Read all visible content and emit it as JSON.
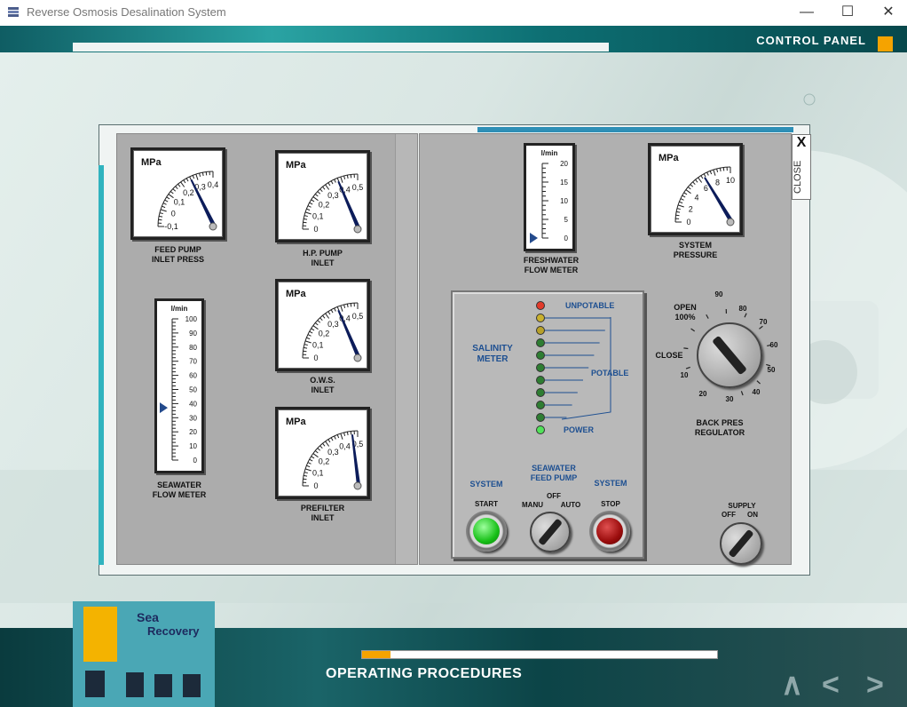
{
  "window": {
    "title": "Reverse Osmosis Desalination System",
    "controls": {
      "minimize": "—",
      "maximize": "☐",
      "close": "✕"
    }
  },
  "header": {
    "control_panel": "CONTROL PANEL",
    "accent": "#f5a300"
  },
  "footer": {
    "operating_procedures": "OPERATING PROCEDURES",
    "progress": 0.08,
    "nav": {
      "up": "∧",
      "prev": "<",
      "next": ">"
    }
  },
  "thumbnail": {
    "brand_line1": "Sea",
    "brand_line2": "Recovery"
  },
  "close": {
    "x": "X",
    "label": "CLOSE"
  },
  "gauges": {
    "feed_pump": {
      "unit": "MPa",
      "ticks": [
        "-0,1",
        "0",
        "0,1",
        "0,2",
        "0,3",
        "0,4"
      ],
      "label1": "FEED  PUMP",
      "label2": "INLET PRESS"
    },
    "hp_pump": {
      "unit": "MPa",
      "ticks": [
        "0",
        "0,1",
        "0,2",
        "0,3",
        "0,4",
        "0,5"
      ],
      "label1": "H.P. PUMP",
      "label2": "INLET"
    },
    "ows": {
      "unit": "MPa",
      "ticks": [
        "0",
        "0,1",
        "0,2",
        "0,3",
        "0,4",
        "0,5"
      ],
      "label1": "O.W.S.",
      "label2": "INLET"
    },
    "prefilter": {
      "unit": "MPa",
      "ticks": [
        "0",
        "0,1",
        "0,2",
        "0,3",
        "0,4",
        "0,5"
      ],
      "label1": "PREFILTER",
      "label2": "INLET"
    },
    "system": {
      "unit": "MPa",
      "ticks": [
        "0",
        "2",
        "4",
        "6",
        "8",
        "10"
      ],
      "label1": "SYSTEM",
      "label2": "PRESSURE"
    }
  },
  "flowmeters": {
    "seawater": {
      "unit": "l/min",
      "ticks": [
        "100",
        "90",
        "80",
        "70",
        "60",
        "50",
        "40",
        "30",
        "20",
        "10",
        "0"
      ],
      "label1": "SEAWATER",
      "label2": "FLOW METER",
      "value": 37
    },
    "freshwater": {
      "unit": "l/min",
      "ticks": [
        "20",
        "15",
        "10",
        "5",
        "0"
      ],
      "label1": "FRESHWATER",
      "label2": "FLOW METER",
      "value": 0
    }
  },
  "salinity": {
    "title1": "SALINITY",
    "title2": "METER",
    "unpotable": "UNPOTABLE",
    "potable": "POTABLE",
    "power": "POWER",
    "led_colors": [
      "#e23a2a",
      "#c9b12e",
      "#b8a12a",
      "#2e7d32",
      "#2e7d32",
      "#2e7d32",
      "#2e7d32",
      "#2e7d32",
      "#2e7d32",
      "#2e7d32",
      "#52e25a"
    ]
  },
  "controls": {
    "system_left": "SYSTEM",
    "start": "START",
    "feed_pump1": "SEAWATER",
    "feed_pump2": "FEED PUMP",
    "off": "OFF",
    "manu": "MANU",
    "auto": "AUTO",
    "system_right": "SYSTEM",
    "stop": "STOP",
    "supply": "SUPPLY",
    "supply_off": "OFF",
    "supply_on": "ON"
  },
  "regulator": {
    "label1": "BACK PRES",
    "label2": "REGULATOR",
    "open": "OPEN",
    "open_pct": "100%",
    "close": "CLOSE",
    "dial": [
      "90",
      "80",
      "70",
      "60",
      "50",
      "40",
      "30",
      "20",
      "10"
    ]
  }
}
